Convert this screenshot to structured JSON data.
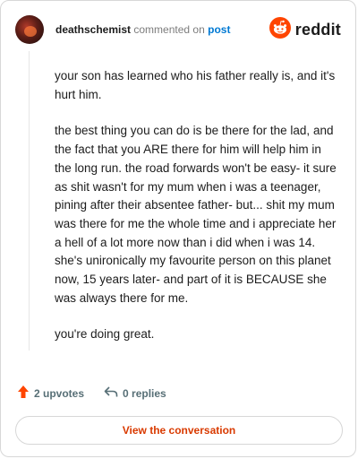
{
  "header": {
    "username": "deathschemist",
    "action_text": "commented on",
    "post_link": "post",
    "brand": "reddit"
  },
  "comment": {
    "paragraphs": [
      "your son has learned who his father really is, and it's hurt him.",
      "the best thing you can do is be there for the lad, and the fact that you ARE there for him will help him in the long run. the road forwards won't be easy- it sure as shit wasn't for my mum when i was a teenager, pining after their absentee father- but... shit my mum was there for me the whole time and i appreciate her a hell of a lot more now than i did when i was 14. she's unironically my favourite person on this planet now, 15 years later- and part of it is BECAUSE she was always there for me.",
      "you're doing great."
    ]
  },
  "actions": {
    "upvotes": "2 upvotes",
    "replies": "0 replies"
  },
  "cta": {
    "label": "View the conversation"
  },
  "colors": {
    "accent": "#d93a00",
    "link": "#0079d3",
    "upvote": "#ff4500"
  },
  "icons": [
    "avatar",
    "reddit-logo-icon",
    "upvote-arrow-icon",
    "reply-arrow-icon"
  ]
}
